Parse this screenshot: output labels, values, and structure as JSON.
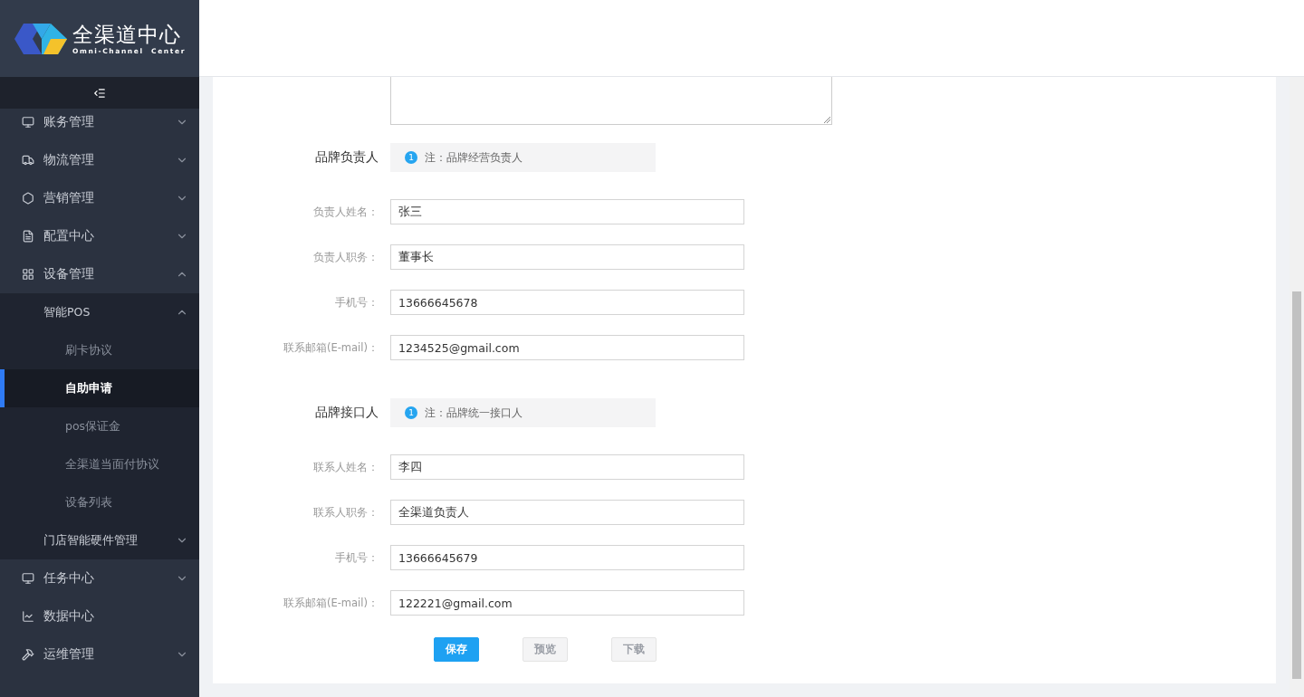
{
  "logo": {
    "title": "全渠道中心",
    "subtitle": "Omni-Channel  Center"
  },
  "sidebar": {
    "items": [
      {
        "label": "账务管理",
        "expanded": false
      },
      {
        "label": "物流管理",
        "expanded": false
      },
      {
        "label": "营销管理",
        "expanded": false
      },
      {
        "label": "配置中心",
        "expanded": false
      },
      {
        "label": "设备管理",
        "expanded": true,
        "children": [
          {
            "label": "智能POS",
            "expanded": true,
            "children": [
              {
                "label": "刷卡协议",
                "selected": false
              },
              {
                "label": "自助申请",
                "selected": true
              },
              {
                "label": "pos保证金",
                "selected": false
              },
              {
                "label": "全渠道当面付协议",
                "selected": false
              },
              {
                "label": "设备列表",
                "selected": false
              }
            ]
          },
          {
            "label": "门店智能硬件管理",
            "expanded": false
          }
        ]
      },
      {
        "label": "任务中心",
        "expanded": false
      },
      {
        "label": "数据中心"
      },
      {
        "label": "运维管理",
        "expanded": false
      }
    ]
  },
  "form": {
    "sections": [
      {
        "title": "品牌负责人",
        "note_badge": "1",
        "note": "注：品牌经营负责人",
        "fields": [
          {
            "label": "负责人姓名：",
            "value": "张三"
          },
          {
            "label": "负责人职务：",
            "value": "董事长"
          },
          {
            "label": "手机号：",
            "value": "13666645678"
          },
          {
            "label": "联系邮箱(E-mail)：",
            "value": "1234525@gmail.com"
          }
        ]
      },
      {
        "title": "品牌接口人",
        "note_badge": "1",
        "note": "注：品牌统一接口人",
        "fields": [
          {
            "label": "联系人姓名：",
            "value": "李四"
          },
          {
            "label": "联系人职务：",
            "value": "全渠道负责人"
          },
          {
            "label": "手机号：",
            "value": "13666645679"
          },
          {
            "label": "联系邮箱(E-mail)：",
            "value": "122221@gmail.com"
          }
        ]
      }
    ],
    "buttons": [
      {
        "label": "保存",
        "disabled": false
      },
      {
        "label": "预览",
        "disabled": true
      },
      {
        "label": "下载",
        "disabled": true
      }
    ]
  }
}
